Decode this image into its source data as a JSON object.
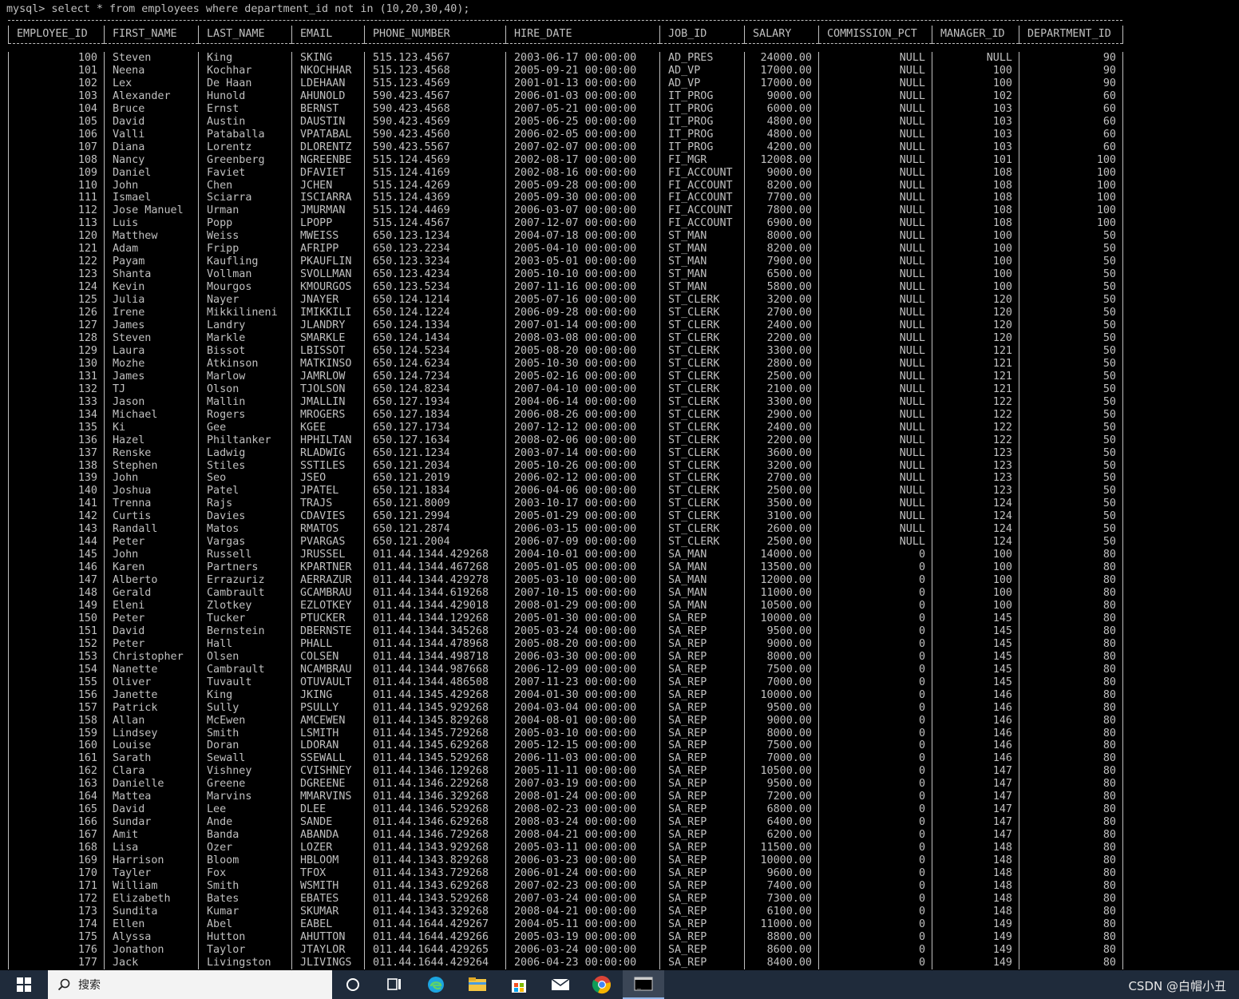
{
  "terminal": {
    "command_line": "mysql> select * from employees where department_id not in (10,20,30,40);",
    "columns": [
      "EMPLOYEE_ID",
      "FIRST_NAME",
      "LAST_NAME",
      "EMAIL",
      "PHONE_NUMBER",
      "HIRE_DATE",
      "JOB_ID",
      "SALARY",
      "COMMISSION_PCT",
      "MANAGER_ID",
      "DEPARTMENT_ID"
    ],
    "rows": [
      [
        "100",
        "Steven",
        "King",
        "SKING",
        "515.123.4567",
        "2003-06-17 00:00:00",
        "AD_PRES",
        "24000.00",
        "NULL",
        "NULL",
        "90"
      ],
      [
        "101",
        "Neena",
        "Kochhar",
        "NKOCHHAR",
        "515.123.4568",
        "2005-09-21 00:00:00",
        "AD_VP",
        "17000.00",
        "NULL",
        "100",
        "90"
      ],
      [
        "102",
        "Lex",
        "De Haan",
        "LDEHAAN",
        "515.123.4569",
        "2001-01-13 00:00:00",
        "AD_VP",
        "17000.00",
        "NULL",
        "100",
        "90"
      ],
      [
        "103",
        "Alexander",
        "Hunold",
        "AHUNOLD",
        "590.423.4567",
        "2006-01-03 00:00:00",
        "IT_PROG",
        "9000.00",
        "NULL",
        "102",
        "60"
      ],
      [
        "104",
        "Bruce",
        "Ernst",
        "BERNST",
        "590.423.4568",
        "2007-05-21 00:00:00",
        "IT_PROG",
        "6000.00",
        "NULL",
        "103",
        "60"
      ],
      [
        "105",
        "David",
        "Austin",
        "DAUSTIN",
        "590.423.4569",
        "2005-06-25 00:00:00",
        "IT_PROG",
        "4800.00",
        "NULL",
        "103",
        "60"
      ],
      [
        "106",
        "Valli",
        "Pataballa",
        "VPATABAL",
        "590.423.4560",
        "2006-02-05 00:00:00",
        "IT_PROG",
        "4800.00",
        "NULL",
        "103",
        "60"
      ],
      [
        "107",
        "Diana",
        "Lorentz",
        "DLORENTZ",
        "590.423.5567",
        "2007-02-07 00:00:00",
        "IT_PROG",
        "4200.00",
        "NULL",
        "103",
        "60"
      ],
      [
        "108",
        "Nancy",
        "Greenberg",
        "NGREENBE",
        "515.124.4569",
        "2002-08-17 00:00:00",
        "FI_MGR",
        "12008.00",
        "NULL",
        "101",
        "100"
      ],
      [
        "109",
        "Daniel",
        "Faviet",
        "DFAVIET",
        "515.124.4169",
        "2002-08-16 00:00:00",
        "FI_ACCOUNT",
        "9000.00",
        "NULL",
        "108",
        "100"
      ],
      [
        "110",
        "John",
        "Chen",
        "JCHEN",
        "515.124.4269",
        "2005-09-28 00:00:00",
        "FI_ACCOUNT",
        "8200.00",
        "NULL",
        "108",
        "100"
      ],
      [
        "111",
        "Ismael",
        "Sciarra",
        "ISCIARRA",
        "515.124.4369",
        "2005-09-30 00:00:00",
        "FI_ACCOUNT",
        "7700.00",
        "NULL",
        "108",
        "100"
      ],
      [
        "112",
        "Jose Manuel",
        "Urman",
        "JMURMAN",
        "515.124.4469",
        "2006-03-07 00:00:00",
        "FI_ACCOUNT",
        "7800.00",
        "NULL",
        "108",
        "100"
      ],
      [
        "113",
        "Luis",
        "Popp",
        "LPOPP",
        "515.124.4567",
        "2007-12-07 00:00:00",
        "FI_ACCOUNT",
        "6900.00",
        "NULL",
        "108",
        "100"
      ],
      [
        "120",
        "Matthew",
        "Weiss",
        "MWEISS",
        "650.123.1234",
        "2004-07-18 00:00:00",
        "ST_MAN",
        "8000.00",
        "NULL",
        "100",
        "50"
      ],
      [
        "121",
        "Adam",
        "Fripp",
        "AFRIPP",
        "650.123.2234",
        "2005-04-10 00:00:00",
        "ST_MAN",
        "8200.00",
        "NULL",
        "100",
        "50"
      ],
      [
        "122",
        "Payam",
        "Kaufling",
        "PKAUFLIN",
        "650.123.3234",
        "2003-05-01 00:00:00",
        "ST_MAN",
        "7900.00",
        "NULL",
        "100",
        "50"
      ],
      [
        "123",
        "Shanta",
        "Vollman",
        "SVOLLMAN",
        "650.123.4234",
        "2005-10-10 00:00:00",
        "ST_MAN",
        "6500.00",
        "NULL",
        "100",
        "50"
      ],
      [
        "124",
        "Kevin",
        "Mourgos",
        "KMOURGOS",
        "650.123.5234",
        "2007-11-16 00:00:00",
        "ST_MAN",
        "5800.00",
        "NULL",
        "100",
        "50"
      ],
      [
        "125",
        "Julia",
        "Nayer",
        "JNAYER",
        "650.124.1214",
        "2005-07-16 00:00:00",
        "ST_CLERK",
        "3200.00",
        "NULL",
        "120",
        "50"
      ],
      [
        "126",
        "Irene",
        "Mikkilineni",
        "IMIKKILI",
        "650.124.1224",
        "2006-09-28 00:00:00",
        "ST_CLERK",
        "2700.00",
        "NULL",
        "120",
        "50"
      ],
      [
        "127",
        "James",
        "Landry",
        "JLANDRY",
        "650.124.1334",
        "2007-01-14 00:00:00",
        "ST_CLERK",
        "2400.00",
        "NULL",
        "120",
        "50"
      ],
      [
        "128",
        "Steven",
        "Markle",
        "SMARKLE",
        "650.124.1434",
        "2008-03-08 00:00:00",
        "ST_CLERK",
        "2200.00",
        "NULL",
        "120",
        "50"
      ],
      [
        "129",
        "Laura",
        "Bissot",
        "LBISSOT",
        "650.124.5234",
        "2005-08-20 00:00:00",
        "ST_CLERK",
        "3300.00",
        "NULL",
        "121",
        "50"
      ],
      [
        "130",
        "Mozhe",
        "Atkinson",
        "MATKINSO",
        "650.124.6234",
        "2005-10-30 00:00:00",
        "ST_CLERK",
        "2800.00",
        "NULL",
        "121",
        "50"
      ],
      [
        "131",
        "James",
        "Marlow",
        "JAMRLOW",
        "650.124.7234",
        "2005-02-16 00:00:00",
        "ST_CLERK",
        "2500.00",
        "NULL",
        "121",
        "50"
      ],
      [
        "132",
        "TJ",
        "Olson",
        "TJOLSON",
        "650.124.8234",
        "2007-04-10 00:00:00",
        "ST_CLERK",
        "2100.00",
        "NULL",
        "121",
        "50"
      ],
      [
        "133",
        "Jason",
        "Mallin",
        "JMALLIN",
        "650.127.1934",
        "2004-06-14 00:00:00",
        "ST_CLERK",
        "3300.00",
        "NULL",
        "122",
        "50"
      ],
      [
        "134",
        "Michael",
        "Rogers",
        "MROGERS",
        "650.127.1834",
        "2006-08-26 00:00:00",
        "ST_CLERK",
        "2900.00",
        "NULL",
        "122",
        "50"
      ],
      [
        "135",
        "Ki",
        "Gee",
        "KGEE",
        "650.127.1734",
        "2007-12-12 00:00:00",
        "ST_CLERK",
        "2400.00",
        "NULL",
        "122",
        "50"
      ],
      [
        "136",
        "Hazel",
        "Philtanker",
        "HPHILTAN",
        "650.127.1634",
        "2008-02-06 00:00:00",
        "ST_CLERK",
        "2200.00",
        "NULL",
        "122",
        "50"
      ],
      [
        "137",
        "Renske",
        "Ladwig",
        "RLADWIG",
        "650.121.1234",
        "2003-07-14 00:00:00",
        "ST_CLERK",
        "3600.00",
        "NULL",
        "123",
        "50"
      ],
      [
        "138",
        "Stephen",
        "Stiles",
        "SSTILES",
        "650.121.2034",
        "2005-10-26 00:00:00",
        "ST_CLERK",
        "3200.00",
        "NULL",
        "123",
        "50"
      ],
      [
        "139",
        "John",
        "Seo",
        "JSEO",
        "650.121.2019",
        "2006-02-12 00:00:00",
        "ST_CLERK",
        "2700.00",
        "NULL",
        "123",
        "50"
      ],
      [
        "140",
        "Joshua",
        "Patel",
        "JPATEL",
        "650.121.1834",
        "2006-04-06 00:00:00",
        "ST_CLERK",
        "2500.00",
        "NULL",
        "123",
        "50"
      ],
      [
        "141",
        "Trenna",
        "Rajs",
        "TRAJS",
        "650.121.8009",
        "2003-10-17 00:00:00",
        "ST_CLERK",
        "3500.00",
        "NULL",
        "124",
        "50"
      ],
      [
        "142",
        "Curtis",
        "Davies",
        "CDAVIES",
        "650.121.2994",
        "2005-01-29 00:00:00",
        "ST_CLERK",
        "3100.00",
        "NULL",
        "124",
        "50"
      ],
      [
        "143",
        "Randall",
        "Matos",
        "RMATOS",
        "650.121.2874",
        "2006-03-15 00:00:00",
        "ST_CLERK",
        "2600.00",
        "NULL",
        "124",
        "50"
      ],
      [
        "144",
        "Peter",
        "Vargas",
        "PVARGAS",
        "650.121.2004",
        "2006-07-09 00:00:00",
        "ST_CLERK",
        "2500.00",
        "NULL",
        "124",
        "50"
      ],
      [
        "145",
        "John",
        "Russell",
        "JRUSSEL",
        "011.44.1344.429268",
        "2004-10-01 00:00:00",
        "SA_MAN",
        "14000.00",
        "0",
        "100",
        "80"
      ],
      [
        "146",
        "Karen",
        "Partners",
        "KPARTNER",
        "011.44.1344.467268",
        "2005-01-05 00:00:00",
        "SA_MAN",
        "13500.00",
        "0",
        "100",
        "80"
      ],
      [
        "147",
        "Alberto",
        "Errazuriz",
        "AERRAZUR",
        "011.44.1344.429278",
        "2005-03-10 00:00:00",
        "SA_MAN",
        "12000.00",
        "0",
        "100",
        "80"
      ],
      [
        "148",
        "Gerald",
        "Cambrault",
        "GCAMBRAU",
        "011.44.1344.619268",
        "2007-10-15 00:00:00",
        "SA_MAN",
        "11000.00",
        "0",
        "100",
        "80"
      ],
      [
        "149",
        "Eleni",
        "Zlotkey",
        "EZLOTKEY",
        "011.44.1344.429018",
        "2008-01-29 00:00:00",
        "SA_MAN",
        "10500.00",
        "0",
        "100",
        "80"
      ],
      [
        "150",
        "Peter",
        "Tucker",
        "PTUCKER",
        "011.44.1344.129268",
        "2005-01-30 00:00:00",
        "SA_REP",
        "10000.00",
        "0",
        "145",
        "80"
      ],
      [
        "151",
        "David",
        "Bernstein",
        "DBERNSTE",
        "011.44.1344.345268",
        "2005-03-24 00:00:00",
        "SA_REP",
        "9500.00",
        "0",
        "145",
        "80"
      ],
      [
        "152",
        "Peter",
        "Hall",
        "PHALL",
        "011.44.1344.478968",
        "2005-08-20 00:00:00",
        "SA_REP",
        "9000.00",
        "0",
        "145",
        "80"
      ],
      [
        "153",
        "Christopher",
        "Olsen",
        "COLSEN",
        "011.44.1344.498718",
        "2006-03-30 00:00:00",
        "SA_REP",
        "8000.00",
        "0",
        "145",
        "80"
      ],
      [
        "154",
        "Nanette",
        "Cambrault",
        "NCAMBRAU",
        "011.44.1344.987668",
        "2006-12-09 00:00:00",
        "SA_REP",
        "7500.00",
        "0",
        "145",
        "80"
      ],
      [
        "155",
        "Oliver",
        "Tuvault",
        "OTUVAULT",
        "011.44.1344.486508",
        "2007-11-23 00:00:00",
        "SA_REP",
        "7000.00",
        "0",
        "145",
        "80"
      ],
      [
        "156",
        "Janette",
        "King",
        "JKING",
        "011.44.1345.429268",
        "2004-01-30 00:00:00",
        "SA_REP",
        "10000.00",
        "0",
        "146",
        "80"
      ],
      [
        "157",
        "Patrick",
        "Sully",
        "PSULLY",
        "011.44.1345.929268",
        "2004-03-04 00:00:00",
        "SA_REP",
        "9500.00",
        "0",
        "146",
        "80"
      ],
      [
        "158",
        "Allan",
        "McEwen",
        "AMCEWEN",
        "011.44.1345.829268",
        "2004-08-01 00:00:00",
        "SA_REP",
        "9000.00",
        "0",
        "146",
        "80"
      ],
      [
        "159",
        "Lindsey",
        "Smith",
        "LSMITH",
        "011.44.1345.729268",
        "2005-03-10 00:00:00",
        "SA_REP",
        "8000.00",
        "0",
        "146",
        "80"
      ],
      [
        "160",
        "Louise",
        "Doran",
        "LDORAN",
        "011.44.1345.629268",
        "2005-12-15 00:00:00",
        "SA_REP",
        "7500.00",
        "0",
        "146",
        "80"
      ],
      [
        "161",
        "Sarath",
        "Sewall",
        "SSEWALL",
        "011.44.1345.529268",
        "2006-11-03 00:00:00",
        "SA_REP",
        "7000.00",
        "0",
        "146",
        "80"
      ],
      [
        "162",
        "Clara",
        "Vishney",
        "CVISHNEY",
        "011.44.1346.129268",
        "2005-11-11 00:00:00",
        "SA_REP",
        "10500.00",
        "0",
        "147",
        "80"
      ],
      [
        "163",
        "Danielle",
        "Greene",
        "DGREENE",
        "011.44.1346.229268",
        "2007-03-19 00:00:00",
        "SA_REP",
        "9500.00",
        "0",
        "147",
        "80"
      ],
      [
        "164",
        "Mattea",
        "Marvins",
        "MMARVINS",
        "011.44.1346.329268",
        "2008-01-24 00:00:00",
        "SA_REP",
        "7200.00",
        "0",
        "147",
        "80"
      ],
      [
        "165",
        "David",
        "Lee",
        "DLEE",
        "011.44.1346.529268",
        "2008-02-23 00:00:00",
        "SA_REP",
        "6800.00",
        "0",
        "147",
        "80"
      ],
      [
        "166",
        "Sundar",
        "Ande",
        "SANDE",
        "011.44.1346.629268",
        "2008-03-24 00:00:00",
        "SA_REP",
        "6400.00",
        "0",
        "147",
        "80"
      ],
      [
        "167",
        "Amit",
        "Banda",
        "ABANDA",
        "011.44.1346.729268",
        "2008-04-21 00:00:00",
        "SA_REP",
        "6200.00",
        "0",
        "147",
        "80"
      ],
      [
        "168",
        "Lisa",
        "Ozer",
        "LOZER",
        "011.44.1343.929268",
        "2005-03-11 00:00:00",
        "SA_REP",
        "11500.00",
        "0",
        "148",
        "80"
      ],
      [
        "169",
        "Harrison",
        "Bloom",
        "HBLOOM",
        "011.44.1343.829268",
        "2006-03-23 00:00:00",
        "SA_REP",
        "10000.00",
        "0",
        "148",
        "80"
      ],
      [
        "170",
        "Tayler",
        "Fox",
        "TFOX",
        "011.44.1343.729268",
        "2006-01-24 00:00:00",
        "SA_REP",
        "9600.00",
        "0",
        "148",
        "80"
      ],
      [
        "171",
        "William",
        "Smith",
        "WSMITH",
        "011.44.1343.629268",
        "2007-02-23 00:00:00",
        "SA_REP",
        "7400.00",
        "0",
        "148",
        "80"
      ],
      [
        "172",
        "Elizabeth",
        "Bates",
        "EBATES",
        "011.44.1343.529268",
        "2007-03-24 00:00:00",
        "SA_REP",
        "7300.00",
        "0",
        "148",
        "80"
      ],
      [
        "173",
        "Sundita",
        "Kumar",
        "SKUMAR",
        "011.44.1343.329268",
        "2008-04-21 00:00:00",
        "SA_REP",
        "6100.00",
        "0",
        "148",
        "80"
      ],
      [
        "174",
        "Ellen",
        "Abel",
        "EABEL",
        "011.44.1644.429267",
        "2004-05-11 00:00:00",
        "SA_REP",
        "11000.00",
        "0",
        "149",
        "80"
      ],
      [
        "175",
        "Alyssa",
        "Hutton",
        "AHUTTON",
        "011.44.1644.429266",
        "2005-03-19 00:00:00",
        "SA_REP",
        "8800.00",
        "0",
        "149",
        "80"
      ],
      [
        "176",
        "Jonathon",
        "Taylor",
        "JTAYLOR",
        "011.44.1644.429265",
        "2006-03-24 00:00:00",
        "SA_REP",
        "8600.00",
        "0",
        "149",
        "80"
      ],
      [
        "177",
        "Jack",
        "Livingston",
        "JLIVINGS",
        "011.44.1644.429264",
        "2006-04-23 00:00:00",
        "SA_REP",
        "8400.00",
        "0",
        "149",
        "80"
      ]
    ]
  },
  "taskbar": {
    "search_placeholder": "搜索",
    "icons": [
      "windows-start-icon",
      "search-icon",
      "cortana-icon",
      "task-view-icon",
      "edge-icon",
      "file-explorer-icon",
      "store-icon",
      "mail-icon",
      "chrome-icon",
      "terminal-icon"
    ]
  },
  "watermark": "CSDN @白帽小丑",
  "colors": {
    "console_bg": "#000000",
    "console_text": "#c0c0c0",
    "taskbar_bg": "#1f2b3b"
  }
}
